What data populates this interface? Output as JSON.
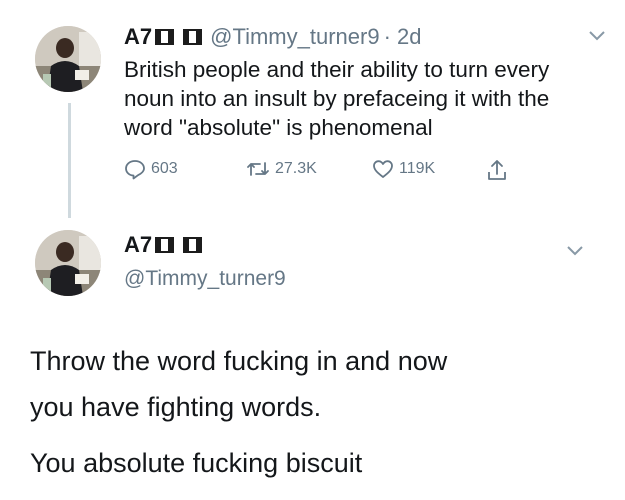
{
  "tweet": {
    "display_name": "A7",
    "handle": "@Timmy_turner9",
    "time_meta": "· 2d",
    "text": "British people and their ability to turn every noun into an insult by prefaceing it with the word \"absolute\" is phenomenal",
    "stats": {
      "replies": "603",
      "retweets": "27.3K",
      "likes": "119K"
    }
  },
  "reply": {
    "display_name": "A7",
    "handle": "@Timmy_turner9",
    "text_line1": "Throw the word fucking in and now",
    "text_line2": "you have fighting words.",
    "text_line3": "You absolute fucking biscuit"
  },
  "icons": {
    "reply": "reply-icon",
    "retweet": "retweet-icon",
    "like": "heart-icon",
    "share": "share-icon",
    "more": "chevron-down-icon",
    "flag": "nigeria-flag-icon"
  },
  "colors": {
    "text": "#14171a",
    "secondary": "#657786",
    "thread_line": "#cfd9de",
    "flag_green": "#1c1c1c"
  }
}
